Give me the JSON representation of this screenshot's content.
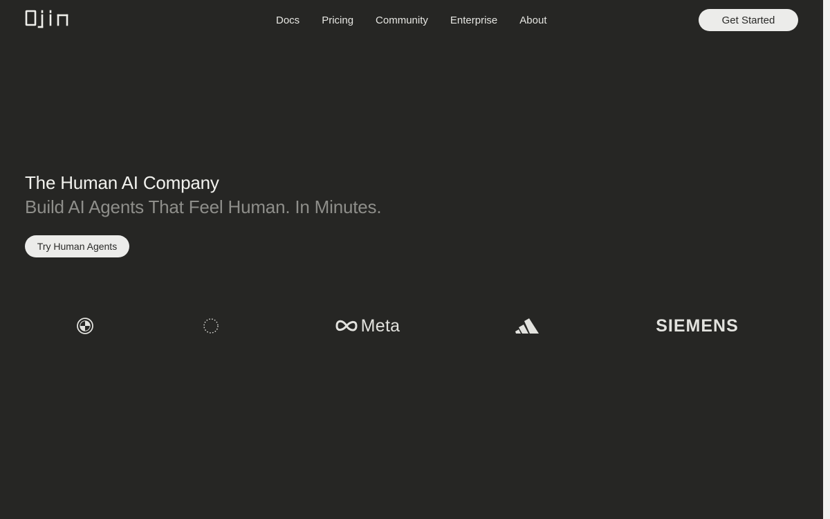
{
  "nav": {
    "logo_text": "Ojin",
    "links": [
      "Docs",
      "Pricing",
      "Community",
      "Enterprise",
      "About"
    ],
    "cta_label": "Get Started"
  },
  "hero": {
    "title": "The Human AI Company",
    "subtitle": "Build AI Agents That Feel Human. In Minutes.",
    "button_label": "Try Human Agents"
  },
  "logos": {
    "brands": [
      "bmw-logo",
      "dotted-circle-logo",
      "meta-logo",
      "adidas-logo",
      "siemens-logo"
    ],
    "meta_text": "Meta",
    "siemens_text": "SIEMENS"
  },
  "colors": {
    "background": "#262624",
    "button_bg": "#ececea",
    "text_primary": "#f2f2ee",
    "text_secondary": "#8e8e8a"
  }
}
